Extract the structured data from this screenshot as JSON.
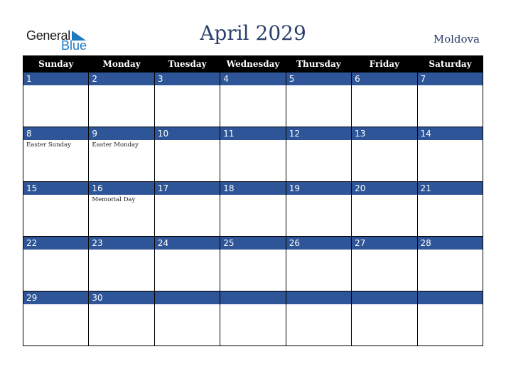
{
  "logo": {
    "general": "General",
    "blue": "Blue"
  },
  "header": {
    "title": "April 2029",
    "country": "Moldova"
  },
  "weekdays": [
    "Sunday",
    "Monday",
    "Tuesday",
    "Wednesday",
    "Thursday",
    "Friday",
    "Saturday"
  ],
  "weeks": [
    [
      {
        "day": "1",
        "event": ""
      },
      {
        "day": "2",
        "event": ""
      },
      {
        "day": "3",
        "event": ""
      },
      {
        "day": "4",
        "event": ""
      },
      {
        "day": "5",
        "event": ""
      },
      {
        "day": "6",
        "event": ""
      },
      {
        "day": "7",
        "event": ""
      }
    ],
    [
      {
        "day": "8",
        "event": "Easter Sunday"
      },
      {
        "day": "9",
        "event": "Easter Monday"
      },
      {
        "day": "10",
        "event": ""
      },
      {
        "day": "11",
        "event": ""
      },
      {
        "day": "12",
        "event": ""
      },
      {
        "day": "13",
        "event": ""
      },
      {
        "day": "14",
        "event": ""
      }
    ],
    [
      {
        "day": "15",
        "event": ""
      },
      {
        "day": "16",
        "event": "Memorial Day"
      },
      {
        "day": "17",
        "event": ""
      },
      {
        "day": "18",
        "event": ""
      },
      {
        "day": "19",
        "event": ""
      },
      {
        "day": "20",
        "event": ""
      },
      {
        "day": "21",
        "event": ""
      }
    ],
    [
      {
        "day": "22",
        "event": ""
      },
      {
        "day": "23",
        "event": ""
      },
      {
        "day": "24",
        "event": ""
      },
      {
        "day": "25",
        "event": ""
      },
      {
        "day": "26",
        "event": ""
      },
      {
        "day": "27",
        "event": ""
      },
      {
        "day": "28",
        "event": ""
      }
    ],
    [
      {
        "day": "29",
        "event": ""
      },
      {
        "day": "30",
        "event": ""
      },
      {
        "day": "",
        "event": ""
      },
      {
        "day": "",
        "event": ""
      },
      {
        "day": "",
        "event": ""
      },
      {
        "day": "",
        "event": ""
      },
      {
        "day": "",
        "event": ""
      }
    ]
  ],
  "colors": {
    "band": "#2d5597",
    "title": "#2a3f6b",
    "logo_blue": "#1d7ac0"
  }
}
